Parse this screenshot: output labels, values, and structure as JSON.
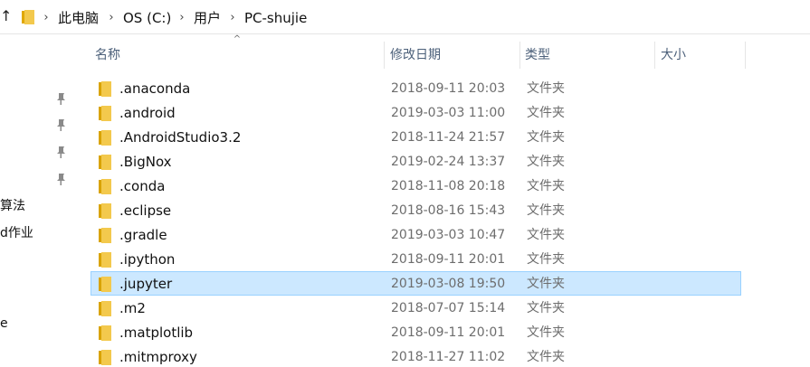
{
  "address": {
    "up_glyph": "↑",
    "crumbs": [
      "此电脑",
      "OS (C:)",
      "用户",
      "PC-shujie"
    ],
    "separator": "›",
    "folder_icon": "folder-icon"
  },
  "nav": {
    "pins": [
      "pin-icon",
      "pin-icon",
      "pin-icon",
      "pin-icon"
    ],
    "items": [
      "算法",
      "d作业",
      "e"
    ]
  },
  "columns": {
    "name": "名称",
    "date": "修改日期",
    "type": "类型",
    "size": "大小",
    "sort_glyph": "^"
  },
  "colors": {
    "selected_bg": "#cce8ff",
    "selected_border": "#99d1ff",
    "folder_yellow": "#f3c94d",
    "header_text": "#4c607a"
  },
  "files": [
    {
      "name": ".anaconda",
      "date": "2018-09-11 20:03",
      "type": "文件夹",
      "size": "",
      "selected": false
    },
    {
      "name": ".android",
      "date": "2019-03-03 11:00",
      "type": "文件夹",
      "size": "",
      "selected": false
    },
    {
      "name": ".AndroidStudio3.2",
      "date": "2018-11-24 21:57",
      "type": "文件夹",
      "size": "",
      "selected": false
    },
    {
      "name": ".BigNox",
      "date": "2019-02-24 13:37",
      "type": "文件夹",
      "size": "",
      "selected": false
    },
    {
      "name": ".conda",
      "date": "2018-11-08 20:18",
      "type": "文件夹",
      "size": "",
      "selected": false
    },
    {
      "name": ".eclipse",
      "date": "2018-08-16 15:43",
      "type": "文件夹",
      "size": "",
      "selected": false
    },
    {
      "name": ".gradle",
      "date": "2019-03-03 10:47",
      "type": "文件夹",
      "size": "",
      "selected": false
    },
    {
      "name": ".ipython",
      "date": "2018-09-11 20:01",
      "type": "文件夹",
      "size": "",
      "selected": false
    },
    {
      "name": ".jupyter",
      "date": "2019-03-08 19:50",
      "type": "文件夹",
      "size": "",
      "selected": true
    },
    {
      "name": ".m2",
      "date": "2018-07-07 15:14",
      "type": "文件夹",
      "size": "",
      "selected": false
    },
    {
      "name": ".matplotlib",
      "date": "2018-09-11 20:01",
      "type": "文件夹",
      "size": "",
      "selected": false
    },
    {
      "name": ".mitmproxy",
      "date": "2018-11-27 11:02",
      "type": "文件夹",
      "size": "",
      "selected": false
    }
  ]
}
